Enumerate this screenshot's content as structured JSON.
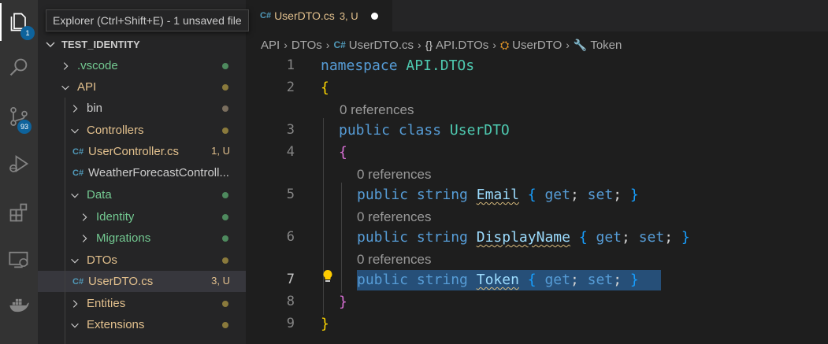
{
  "colors": {
    "accent_badge": "#0e639c",
    "modified": "#e2c08d",
    "untracked": "#73c991",
    "selection": "#264f78"
  },
  "activity_bar": {
    "explorer_badge": "1",
    "source_control_badge": "93",
    "icons": [
      "files-icon",
      "search-icon",
      "source-control-icon",
      "run-debug-icon",
      "extensions-icon",
      "remote-explorer-icon",
      "docker-icon"
    ]
  },
  "tooltip": "Explorer (Ctrl+Shift+E) - 1 unsaved file",
  "explorer": {
    "workspace": "TEST_IDENTITY",
    "items": [
      {
        "label": ".vscode",
        "kind": "folder",
        "state": "collapsed",
        "color": "#73c991",
        "dot": "#4e8a5e"
      },
      {
        "label": "API",
        "kind": "folder",
        "state": "expanded",
        "color": "#e2c08d",
        "dot": "#8a7a3c"
      },
      {
        "label": "bin",
        "kind": "folder",
        "state": "collapsed",
        "color": "#cccccc",
        "dot": "#7a6e5e"
      },
      {
        "label": "Controllers",
        "kind": "folder",
        "state": "expanded",
        "color": "#e2c08d",
        "dot": "#8a7a3c"
      },
      {
        "label": "UserController.cs",
        "kind": "file",
        "color": "#e2c08d",
        "status": "1, U"
      },
      {
        "label": "WeatherForecastControll...",
        "kind": "file",
        "color": "#cccccc"
      },
      {
        "label": "Data",
        "kind": "folder",
        "state": "expanded",
        "color": "#73c991",
        "dot": "#4e8a5e"
      },
      {
        "label": "Identity",
        "kind": "folder",
        "state": "collapsed",
        "color": "#73c991",
        "dot": "#4e8a5e"
      },
      {
        "label": "Migrations",
        "kind": "folder",
        "state": "collapsed",
        "color": "#73c991",
        "dot": "#4e8a5e"
      },
      {
        "label": "DTOs",
        "kind": "folder",
        "state": "expanded",
        "color": "#e2c08d",
        "dot": "#8a7a3c"
      },
      {
        "label": "UserDTO.cs",
        "kind": "file",
        "color": "#e2c08d",
        "status": "3, U",
        "selected": true
      },
      {
        "label": "Entities",
        "kind": "folder",
        "state": "collapsed",
        "color": "#e2c08d",
        "dot": "#8a7a3c"
      },
      {
        "label": "Extensions",
        "kind": "folder",
        "state": "expanded",
        "color": "#e2c08d",
        "dot": "#8a7a3c"
      }
    ]
  },
  "tab": {
    "name": "UserDTO.cs",
    "status": "3, U"
  },
  "breadcrumb": [
    "API",
    "DTOs",
    "UserDTO.cs",
    "API.DTOs",
    "UserDTO",
    "Token"
  ],
  "editor": {
    "codelens": "0 references",
    "lines": [
      "1",
      "2",
      "3",
      "4",
      "5",
      "6",
      "7",
      "8",
      "9"
    ],
    "code": {
      "namespace_kw": "namespace",
      "namespace_name": "API.DTOs",
      "open_brace": "{",
      "close_brace": "}",
      "public_kw": "public",
      "class_kw": "class",
      "class_name": "UserDTO",
      "string_kw": "string",
      "get_kw": "get",
      "set_kw": "set",
      "semicolon": ";",
      "props": [
        "Email",
        "DisplayName",
        "Token"
      ]
    }
  }
}
